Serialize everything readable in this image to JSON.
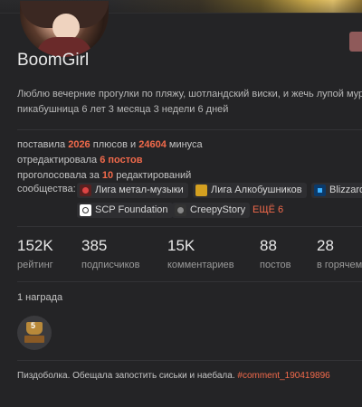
{
  "profile": {
    "username": "BoomGirl",
    "bio_line1": "Люблю вечерние прогулки по пляжу, шотландский виски, и жечь лупой мура",
    "bio_line2": "пикабушница 6 лет 3 месяца 3 недели 6 дней"
  },
  "activity": {
    "votes_prefix": "поставила",
    "plus_count": "2026",
    "plus_mid": "плюсов и",
    "minus_count": "24604",
    "minus_suffix": "минуса",
    "edited_prefix": "отредактировала",
    "edited_posts": "6 постов",
    "voted_prefix": "проголосовала за",
    "voted_count": "10",
    "voted_suffix": "редактирований"
  },
  "communities": {
    "label": "сообщества:",
    "items": [
      {
        "name": "Лига метал-музыки",
        "icon": "metal-icon"
      },
      {
        "name": "Лига Алкобушников",
        "icon": "alco-icon"
      },
      {
        "name": "Blizzard",
        "icon": "blizzard-icon"
      },
      {
        "name": "SCP Foundation",
        "icon": "scp-icon"
      },
      {
        "name": "CreepyStory",
        "icon": "creepy-icon"
      }
    ],
    "more": "ЕЩЁ 6"
  },
  "counters": [
    {
      "value": "152K",
      "label": "рейтинг"
    },
    {
      "value": "385",
      "label": "подписчиков"
    },
    {
      "value": "15K",
      "label": "комментариев"
    },
    {
      "value": "88",
      "label": "постов"
    },
    {
      "value": "28",
      "label": "в горячем"
    }
  ],
  "awards": {
    "title": "1 награда",
    "badge_number": "5"
  },
  "note": {
    "text": "Пиздоболка. Обещала запостить сиськи и наебала.",
    "link": "#comment_190419896"
  },
  "colors": {
    "accent": "#f26a4b",
    "background": "#1c1c1e",
    "card": "#242426"
  }
}
